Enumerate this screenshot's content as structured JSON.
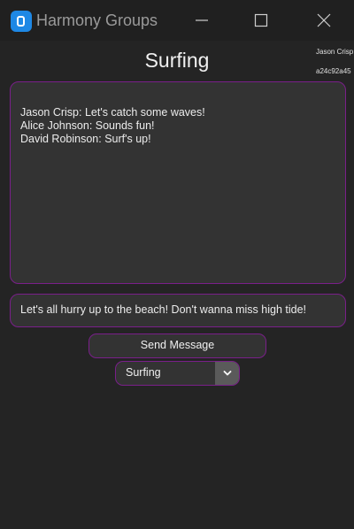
{
  "window": {
    "title": "Harmony Groups",
    "icons": {
      "app": "app-logo-icon",
      "minimize": "minimize-icon",
      "maximize": "maximize-icon",
      "close": "close-icon"
    }
  },
  "group": {
    "title": "Surfing"
  },
  "user": {
    "name": "Jason Crisp",
    "id": "a24c92a45"
  },
  "chat": {
    "messages": [
      "Jason Crisp: Let's catch some waves!",
      "Alice Johnson: Sounds fun!",
      "David Robinson: Surf's up!"
    ]
  },
  "composer": {
    "value": "Let's all hurry up to the beach! Don't wanna miss high tide!",
    "send_label": "Send Message"
  },
  "group_select": {
    "selected": "Surfing",
    "arrow_icon": "chevron-down-icon"
  },
  "colors": {
    "background": "#242424",
    "titlebar": "#202020",
    "accent_border": "#7a1f8a",
    "field_background": "#333333",
    "app_icon": "#1e88e5"
  }
}
